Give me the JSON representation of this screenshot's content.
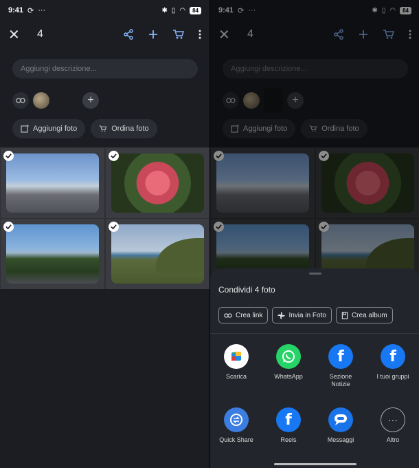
{
  "status": {
    "time": "9:41",
    "battery": "84"
  },
  "toolbar": {
    "count": "4"
  },
  "description": {
    "placeholder": "Aggiungi descrizione..."
  },
  "actions": {
    "add_photos": "Aggiungi foto",
    "order_photos": "Ordina foto"
  },
  "photos": [
    {
      "label": "photo-town",
      "selected": true
    },
    {
      "label": "photo-flower",
      "selected": true
    },
    {
      "label": "photo-coast",
      "selected": true
    },
    {
      "label": "photo-hill",
      "selected": true
    }
  ],
  "share_sheet": {
    "title": "Condividi 4 foto",
    "chips": [
      "Crea link",
      "Invia in Foto",
      "Crea album"
    ],
    "apps": [
      {
        "label": "Scarica",
        "icon": "scarica-icon"
      },
      {
        "label": "WhatsApp",
        "icon": "whatsapp-icon"
      },
      {
        "label": "Sezione Notizie",
        "icon": "facebook-icon"
      },
      {
        "label": "I tuoi gruppi",
        "icon": "facebook-icon"
      },
      {
        "label": "Quick Share",
        "icon": "quick-share-icon"
      },
      {
        "label": "Reels",
        "icon": "facebook-icon"
      },
      {
        "label": "Messaggi",
        "icon": "messages-icon"
      },
      {
        "label": "Altro",
        "icon": "more-icon"
      }
    ]
  },
  "colors": {
    "accent": "#8ab4f8",
    "facebook": "#1877f2",
    "whatsapp": "#25d366"
  }
}
